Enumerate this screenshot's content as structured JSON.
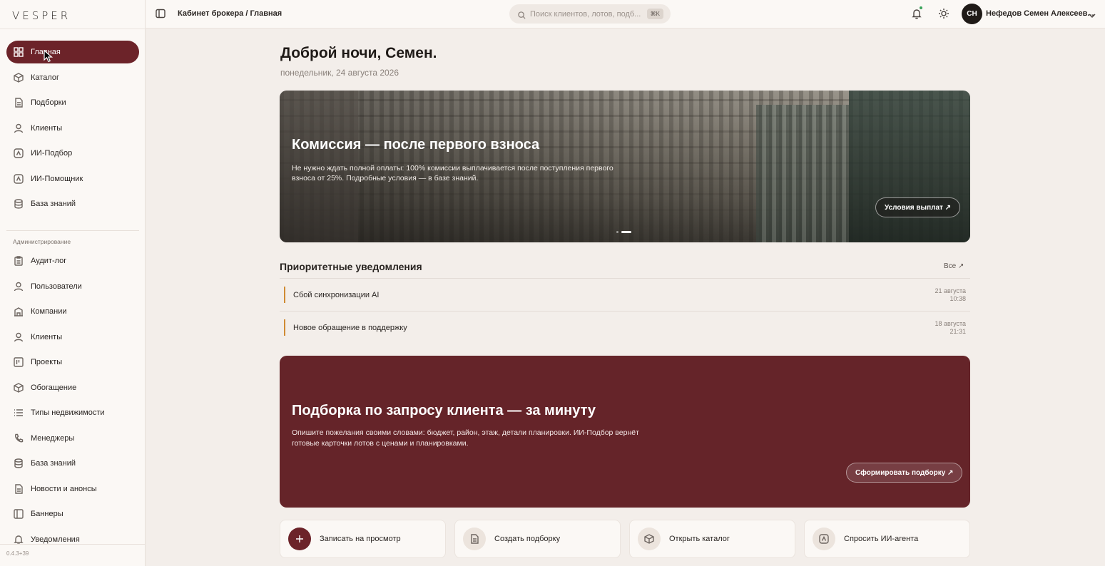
{
  "sidebar": {
    "logo": "VESPER",
    "items": [
      {
        "label": "Главная",
        "icon": "grid-icon"
      },
      {
        "label": "Каталог",
        "icon": "cube-icon"
      },
      {
        "label": "Подборки",
        "icon": "document-icon"
      },
      {
        "label": "Клиенты",
        "icon": "user-icon"
      },
      {
        "label": "ИИ-Подбор",
        "icon": "ai-icon"
      },
      {
        "label": "ИИ-Помощник",
        "icon": "ai-icon"
      },
      {
        "label": "База знаний",
        "icon": "database-icon"
      }
    ],
    "admin_label": "Администрирование",
    "admin_items": [
      {
        "label": "Аудит-лог",
        "icon": "clipboard-icon"
      },
      {
        "label": "Пользователи",
        "icon": "user-icon"
      },
      {
        "label": "Компании",
        "icon": "building-icon"
      },
      {
        "label": "Клиенты",
        "icon": "user-icon"
      },
      {
        "label": "Проекты",
        "icon": "kanban-icon"
      },
      {
        "label": "Обогащение",
        "icon": "cube-icon"
      },
      {
        "label": "Типы недвижимости",
        "icon": "list-icon"
      },
      {
        "label": "Менеджеры",
        "icon": "phone-icon"
      },
      {
        "label": "База знаний",
        "icon": "database-icon"
      },
      {
        "label": "Новости и анонсы",
        "icon": "document-icon"
      },
      {
        "label": "Баннеры",
        "icon": "panel-icon"
      },
      {
        "label": "Уведомления",
        "icon": "bell-icon"
      }
    ],
    "version": "0.4.3+39"
  },
  "header": {
    "breadcrumb": "Кабинет брокера / Главная",
    "search_placeholder": "Поиск клиентов, лотов, подб...",
    "search_shortcut": "⌘K",
    "user_initials": "СН",
    "user_name": "Нефедов Семен Алексеев..."
  },
  "main": {
    "greeting": "Доброй ночи, Семен.",
    "date": "понедельник, 24 августа 2026",
    "hero": {
      "title": "Комиссия — после первого взноса",
      "text": "Не нужно ждать полной оплаты: 100% комиссии выплачивается после поступления первого взноса от 25%. Подробные условия — в базе знаний.",
      "button": "Условия выплат ↗"
    },
    "notifications": {
      "title": "Приоритетные уведомления",
      "all_link": "Все ↗",
      "items": [
        {
          "text": "Сбой синхронизации AI",
          "date": "21 августа",
          "time": "10:38"
        },
        {
          "text": "Новое обращение в поддержку",
          "date": "18 августа",
          "time": "21:31"
        }
      ]
    },
    "promo": {
      "title": "Подборка по запросу клиента — за минуту",
      "text": "Опишите пожелания своими словами: бюджет, район, этаж, детали планировки. ИИ-Подбор вернёт готовые карточки лотов с ценами и планировками.",
      "button": "Сформировать подборку ↗"
    },
    "actions": [
      {
        "label": "Записать на просмотр",
        "icon": "plus-icon"
      },
      {
        "label": "Создать подборку",
        "icon": "document-icon"
      },
      {
        "label": "Открыть каталог",
        "icon": "cube-icon"
      },
      {
        "label": "Спросить ИИ-агента",
        "icon": "ai-icon"
      }
    ]
  },
  "colors": {
    "accent": "#6c2329",
    "promo_bg": "#652429",
    "notif_marker": "#d08b33",
    "background": "#f3eeea"
  }
}
